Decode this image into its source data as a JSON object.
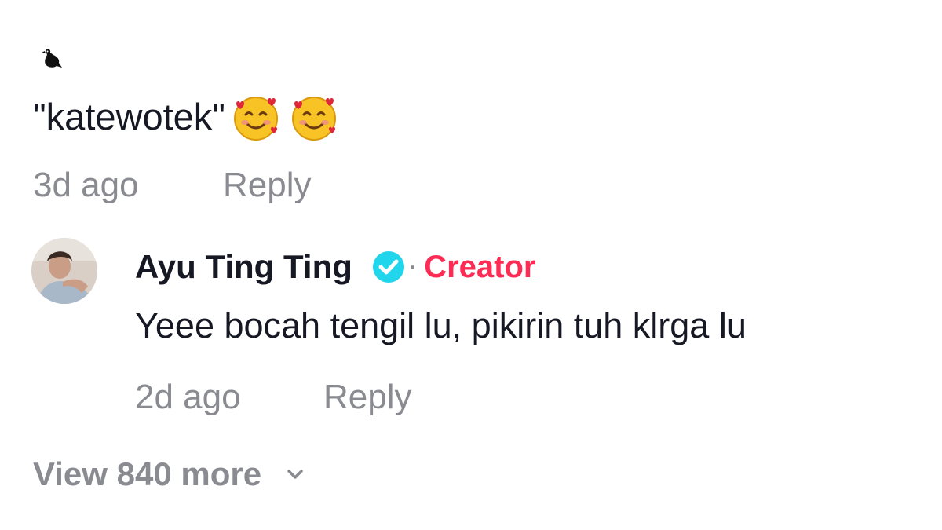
{
  "parent_comment": {
    "leading_icon": "bird-icon",
    "text": "\"katewotek\"",
    "emojis": [
      "smiling-face-with-hearts-icon",
      "smiling-face-with-hearts-icon"
    ],
    "timestamp": "3d ago",
    "reply_label": "Reply"
  },
  "reply_comment": {
    "author": "Ayu Ting Ting",
    "verified_icon": "verified-check-icon",
    "separator": "·",
    "badge": "Creator",
    "text": "Yeee bocah tengil lu, pikirin tuh klrga lu",
    "timestamp": "2d ago",
    "reply_label": "Reply"
  },
  "view_more": {
    "label": "View 840 more",
    "icon": "chevron-down-icon"
  },
  "colors": {
    "text_primary": "#161823",
    "text_secondary": "#8a8b91",
    "creator_badge": "#fe2c55",
    "verified": "#20d5ec"
  }
}
